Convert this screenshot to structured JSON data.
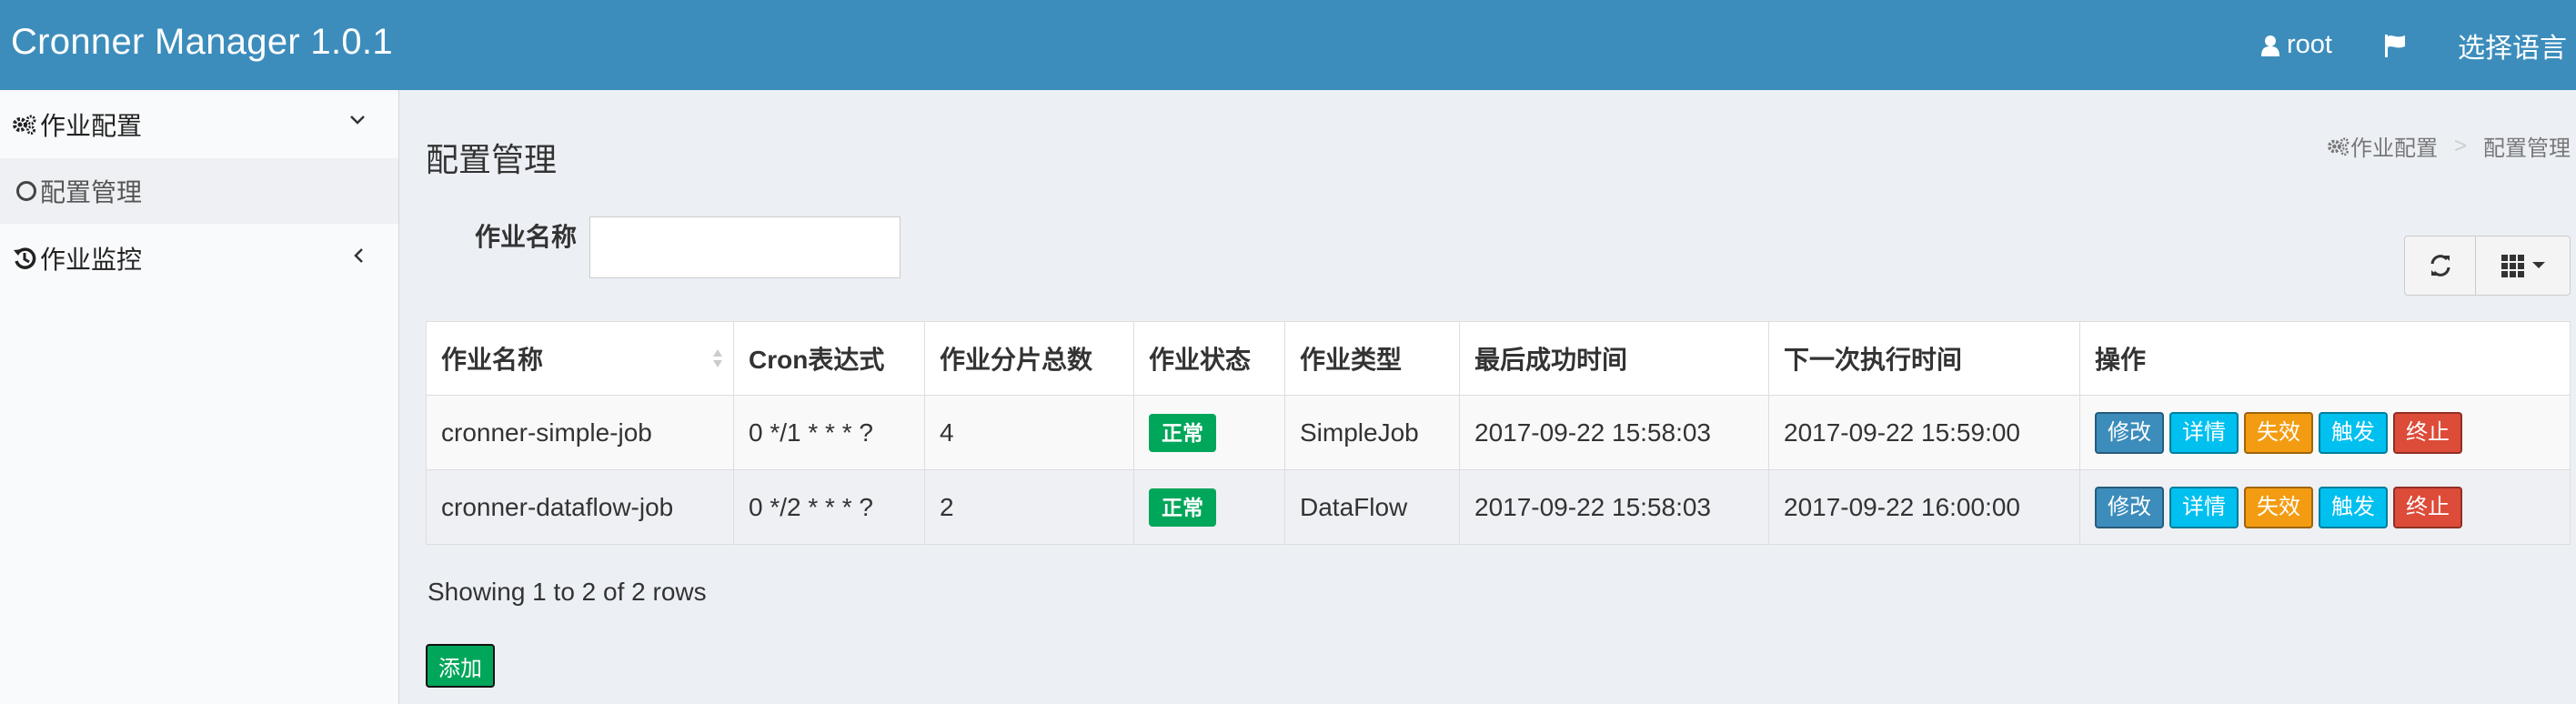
{
  "app": {
    "title": "Cronner Manager 1.0.1"
  },
  "header": {
    "user": "root",
    "language": "选择语言"
  },
  "sidebar": {
    "items": [
      {
        "label": "作业配置",
        "icon": "gears-icon",
        "expanded": true,
        "children": [
          {
            "label": "配置管理"
          }
        ]
      },
      {
        "label": "作业监控",
        "icon": "history-icon",
        "expanded": false
      }
    ]
  },
  "page": {
    "title": "配置管理"
  },
  "breadcrumb": {
    "items": [
      "作业配置",
      "配置管理"
    ],
    "separator": ">"
  },
  "search": {
    "label": "作业名称",
    "value": ""
  },
  "table": {
    "columns": [
      "作业名称",
      "Cron表达式",
      "作业分片总数",
      "作业状态",
      "作业类型",
      "最后成功时间",
      "下一次执行时间",
      "操作"
    ],
    "rows": [
      {
        "name": "cronner-simple-job",
        "cron": "0 */1 * * * ?",
        "shards": "4",
        "status": "正常",
        "type": "SimpleJob",
        "last_success": "2017-09-22 15:58:03",
        "next_exec": "2017-09-22 15:59:00"
      },
      {
        "name": "cronner-dataflow-job",
        "cron": "0 */2 * * * ?",
        "shards": "2",
        "status": "正常",
        "type": "DataFlow",
        "last_success": "2017-09-22 15:58:03",
        "next_exec": "2017-09-22 16:00:00"
      }
    ],
    "actions": {
      "modify": "修改",
      "detail": "详情",
      "disable": "失效",
      "trigger": "触发",
      "terminate": "终止"
    }
  },
  "pagination": {
    "info": "Showing 1 to 2 of 2 rows"
  },
  "add_button": "添加",
  "colors": {
    "header": "#3c8dbc",
    "success": "#00a65a",
    "info": "#00c0ef",
    "warning": "#f39c12",
    "danger": "#dd4b39"
  }
}
